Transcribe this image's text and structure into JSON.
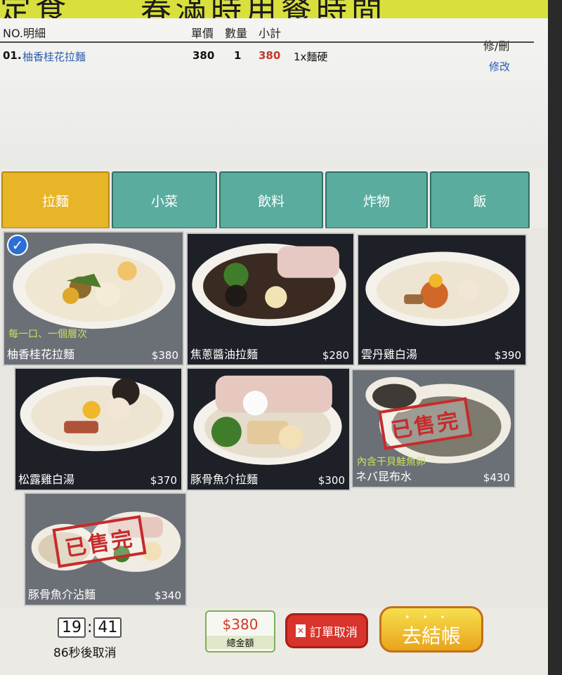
{
  "banner": {
    "text": "定食　　春滿時用餐時間"
  },
  "order": {
    "headers": {
      "no_detail": "NO.明細",
      "unit_price": "單價",
      "qty": "數量",
      "subtotal": "小計",
      "edit_delete": "修/刪"
    },
    "rows": [
      {
        "no": "01.",
        "item": "柚香桂花拉麵",
        "price": "380",
        "qty": "1",
        "subtotal": "380",
        "note": "1x麵硬",
        "edit": "修改"
      }
    ]
  },
  "tabs": [
    {
      "label": "拉麵",
      "active": true
    },
    {
      "label": "小菜",
      "active": false
    },
    {
      "label": "飲料",
      "active": false
    },
    {
      "label": "炸物",
      "active": false
    },
    {
      "label": "飯",
      "active": false
    }
  ],
  "menu": [
    {
      "name": "柚香桂花拉麵",
      "price": "$380",
      "subtitle": "每一口、一個層次",
      "selected": true,
      "sold_out": false
    },
    {
      "name": "焦蔥醬油拉麵",
      "price": "$280",
      "selected": false,
      "sold_out": false
    },
    {
      "name": "雲丹雞白湯",
      "price": "$390",
      "selected": false,
      "sold_out": false
    },
    {
      "name": "松露雞白湯",
      "price": "$370",
      "selected": false,
      "sold_out": false
    },
    {
      "name": "豚骨魚介拉麵",
      "price": "$300",
      "selected": false,
      "sold_out": false
    },
    {
      "name": "ネバ昆布水",
      "price": "$430",
      "subtitle": "內含干貝鮭魚卵",
      "selected": false,
      "sold_out": true,
      "sold_label": "已售完"
    },
    {
      "name": "豚骨魚介沾麵",
      "price": "$340",
      "selected": false,
      "sold_out": true,
      "sold_label": "已售完"
    }
  ],
  "footer": {
    "clock_h": "19",
    "clock_sep": ":",
    "clock_m": "41",
    "countdown": "86秒後取消",
    "total_value": "$380",
    "total_label": "總金額",
    "cancel_label": "訂單取消",
    "checkout_label": "去結帳"
  },
  "colors": {
    "tab": "#5aac9e",
    "tab_active": "#e8b428",
    "checkout": "#e9a41a",
    "cancel": "#d8342c"
  }
}
